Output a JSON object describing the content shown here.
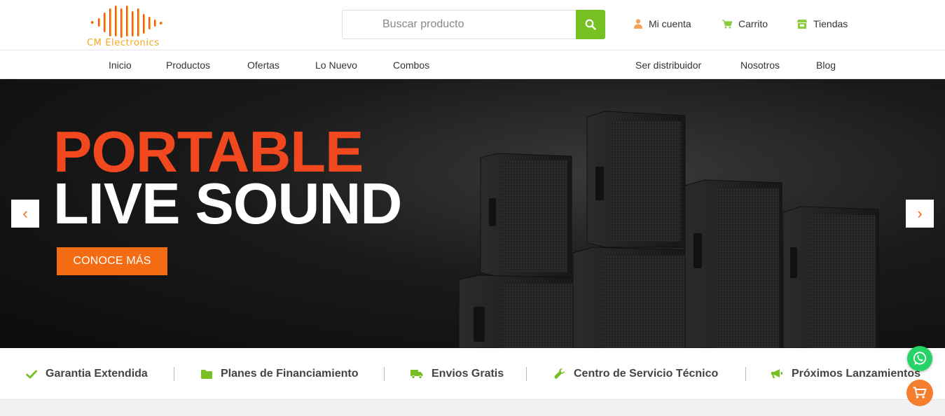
{
  "brand": {
    "name": "CM Electronics",
    "colors": {
      "accent_green": "#76c024",
      "accent_orange": "#f36c14",
      "hero_red": "#f1481f"
    }
  },
  "search": {
    "placeholder": "Buscar producto",
    "icon": "search-icon"
  },
  "header_links": [
    {
      "label": "Mi cuenta",
      "icon": "user-icon"
    },
    {
      "label": "Carrito",
      "icon": "cart-icon"
    },
    {
      "label": "Tiendas",
      "icon": "store-icon"
    }
  ],
  "nav": {
    "left": [
      "Inicio",
      "Productos",
      "Ofertas",
      "Lo Nuevo",
      "Combos"
    ],
    "right": [
      "Ser distribuidor",
      "Nosotros",
      "Blog"
    ]
  },
  "hero": {
    "title_line1": "PORTABLE",
    "title_line2": "LIVE SOUND",
    "cta": "CONOCE MÁS",
    "prev": "‹",
    "next": "›"
  },
  "features": [
    {
      "label": "Garantia Extendida",
      "icon": "check-icon"
    },
    {
      "label": "Planes de Financiamiento",
      "icon": "folder-icon"
    },
    {
      "label": "Envios Gratis",
      "icon": "truck-icon"
    },
    {
      "label": "Centro de Servicio Técnico",
      "icon": "wrench-icon"
    },
    {
      "label": "Próximos Lanzamientos",
      "icon": "megaphone-icon"
    }
  ]
}
